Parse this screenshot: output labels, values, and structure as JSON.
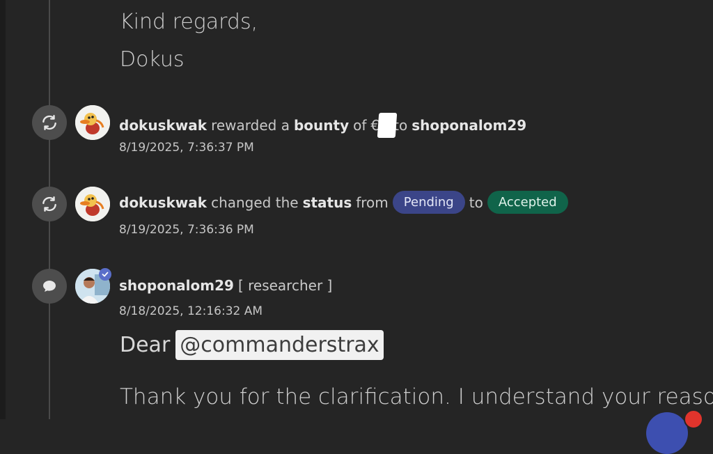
{
  "message_tail": {
    "line1": "Kind regards,",
    "line2": "Dokus"
  },
  "events": [
    {
      "icon": "sync-icon",
      "actor": "dokuskwak",
      "verb": "rewarded a",
      "object": "bounty",
      "of_word": "of",
      "amount_prefix": "€",
      "to_word": "to",
      "target": "shoponalom29",
      "timestamp": "8/19/2025, 7:36:37 PM"
    },
    {
      "icon": "sync-icon",
      "actor": "dokuskwak",
      "verb": "changed the",
      "object": "status",
      "from_word": "from",
      "from_status": "Pending",
      "to_word": "to",
      "to_status": "Accepted",
      "timestamp": "8/19/2025, 7:36:36 PM"
    }
  ],
  "comment": {
    "icon": "comment-icon",
    "author": "shoponalom29",
    "role": "[ researcher ]",
    "timestamp": "8/18/2025, 12:16:32 AM",
    "greeting": "Dear",
    "mention": "@commanderstrax",
    "body": "Thank you for the clarification. I understand your reason"
  },
  "colors": {
    "background": "#252525",
    "pending": "#3b4588",
    "accepted": "#10644a",
    "verified": "#5a6ec9"
  }
}
